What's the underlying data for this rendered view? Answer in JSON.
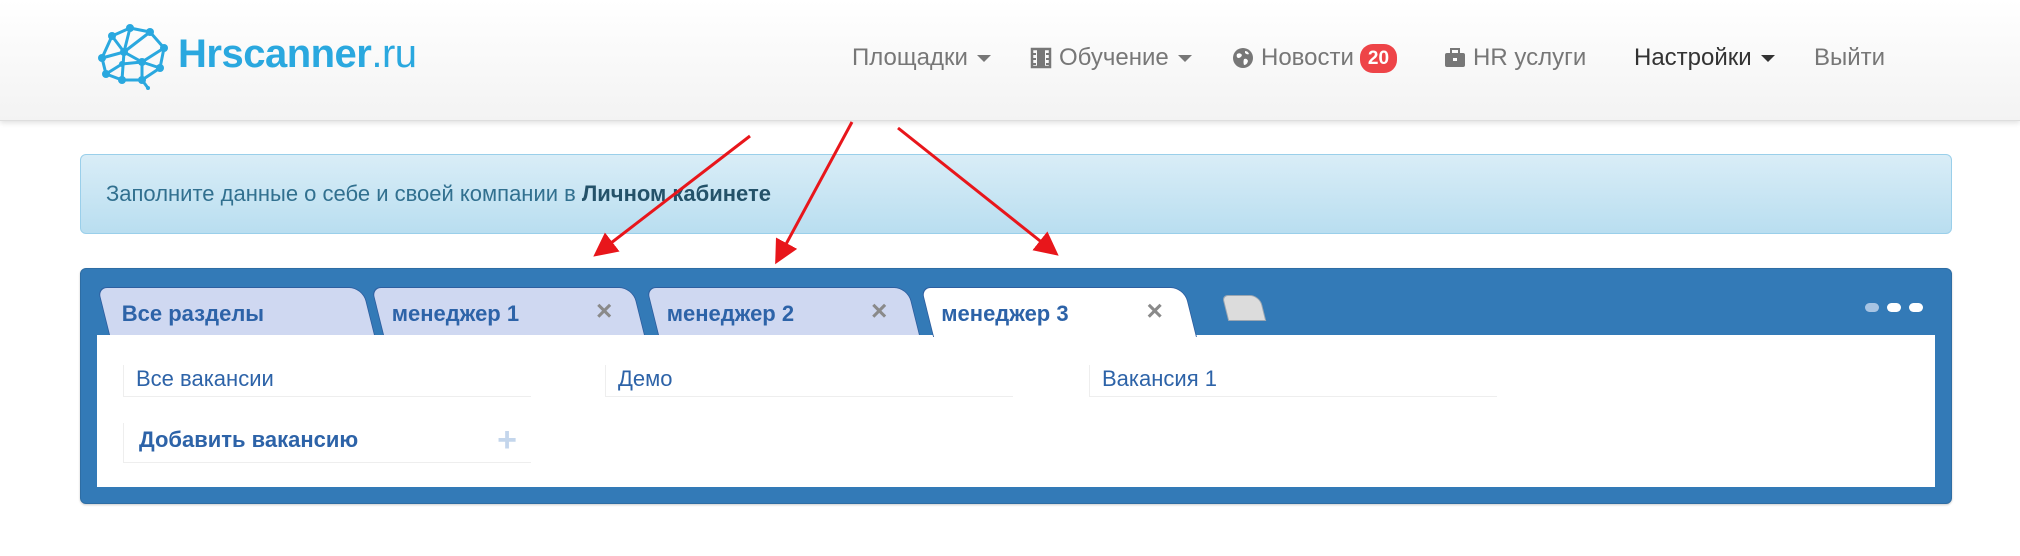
{
  "brand": {
    "name": "Hrscanner",
    "tld": ".ru"
  },
  "nav": {
    "platforms": "Площадки",
    "learning": "Обучение",
    "news": "Новости",
    "news_badge": "20",
    "hr_services": "HR услуги",
    "settings": "Настройки",
    "logout": "Выйти"
  },
  "alert": {
    "text": "Заполните данные о себе и своей компании в",
    "link": "Личном кабинете"
  },
  "tabs": [
    {
      "label": "Все разделы",
      "closable": false
    },
    {
      "label": "менеджер 1",
      "closable": true
    },
    {
      "label": "менеджер 2",
      "closable": true
    },
    {
      "label": "менеджер 3",
      "closable": true,
      "active": true
    }
  ],
  "content": {
    "all_vacancies": "Все вакансии",
    "add_vacancy": "Добавить вакансию",
    "demo": "Демо",
    "vacancy_1": "Вакансия 1"
  },
  "icons": {
    "close": "×",
    "plus": "+"
  },
  "colors": {
    "brand": "#2aa8df",
    "panel": "#337ab7",
    "tab": "#cfd8f1",
    "badge": "#ee4448",
    "arrow": "#e8161b"
  }
}
